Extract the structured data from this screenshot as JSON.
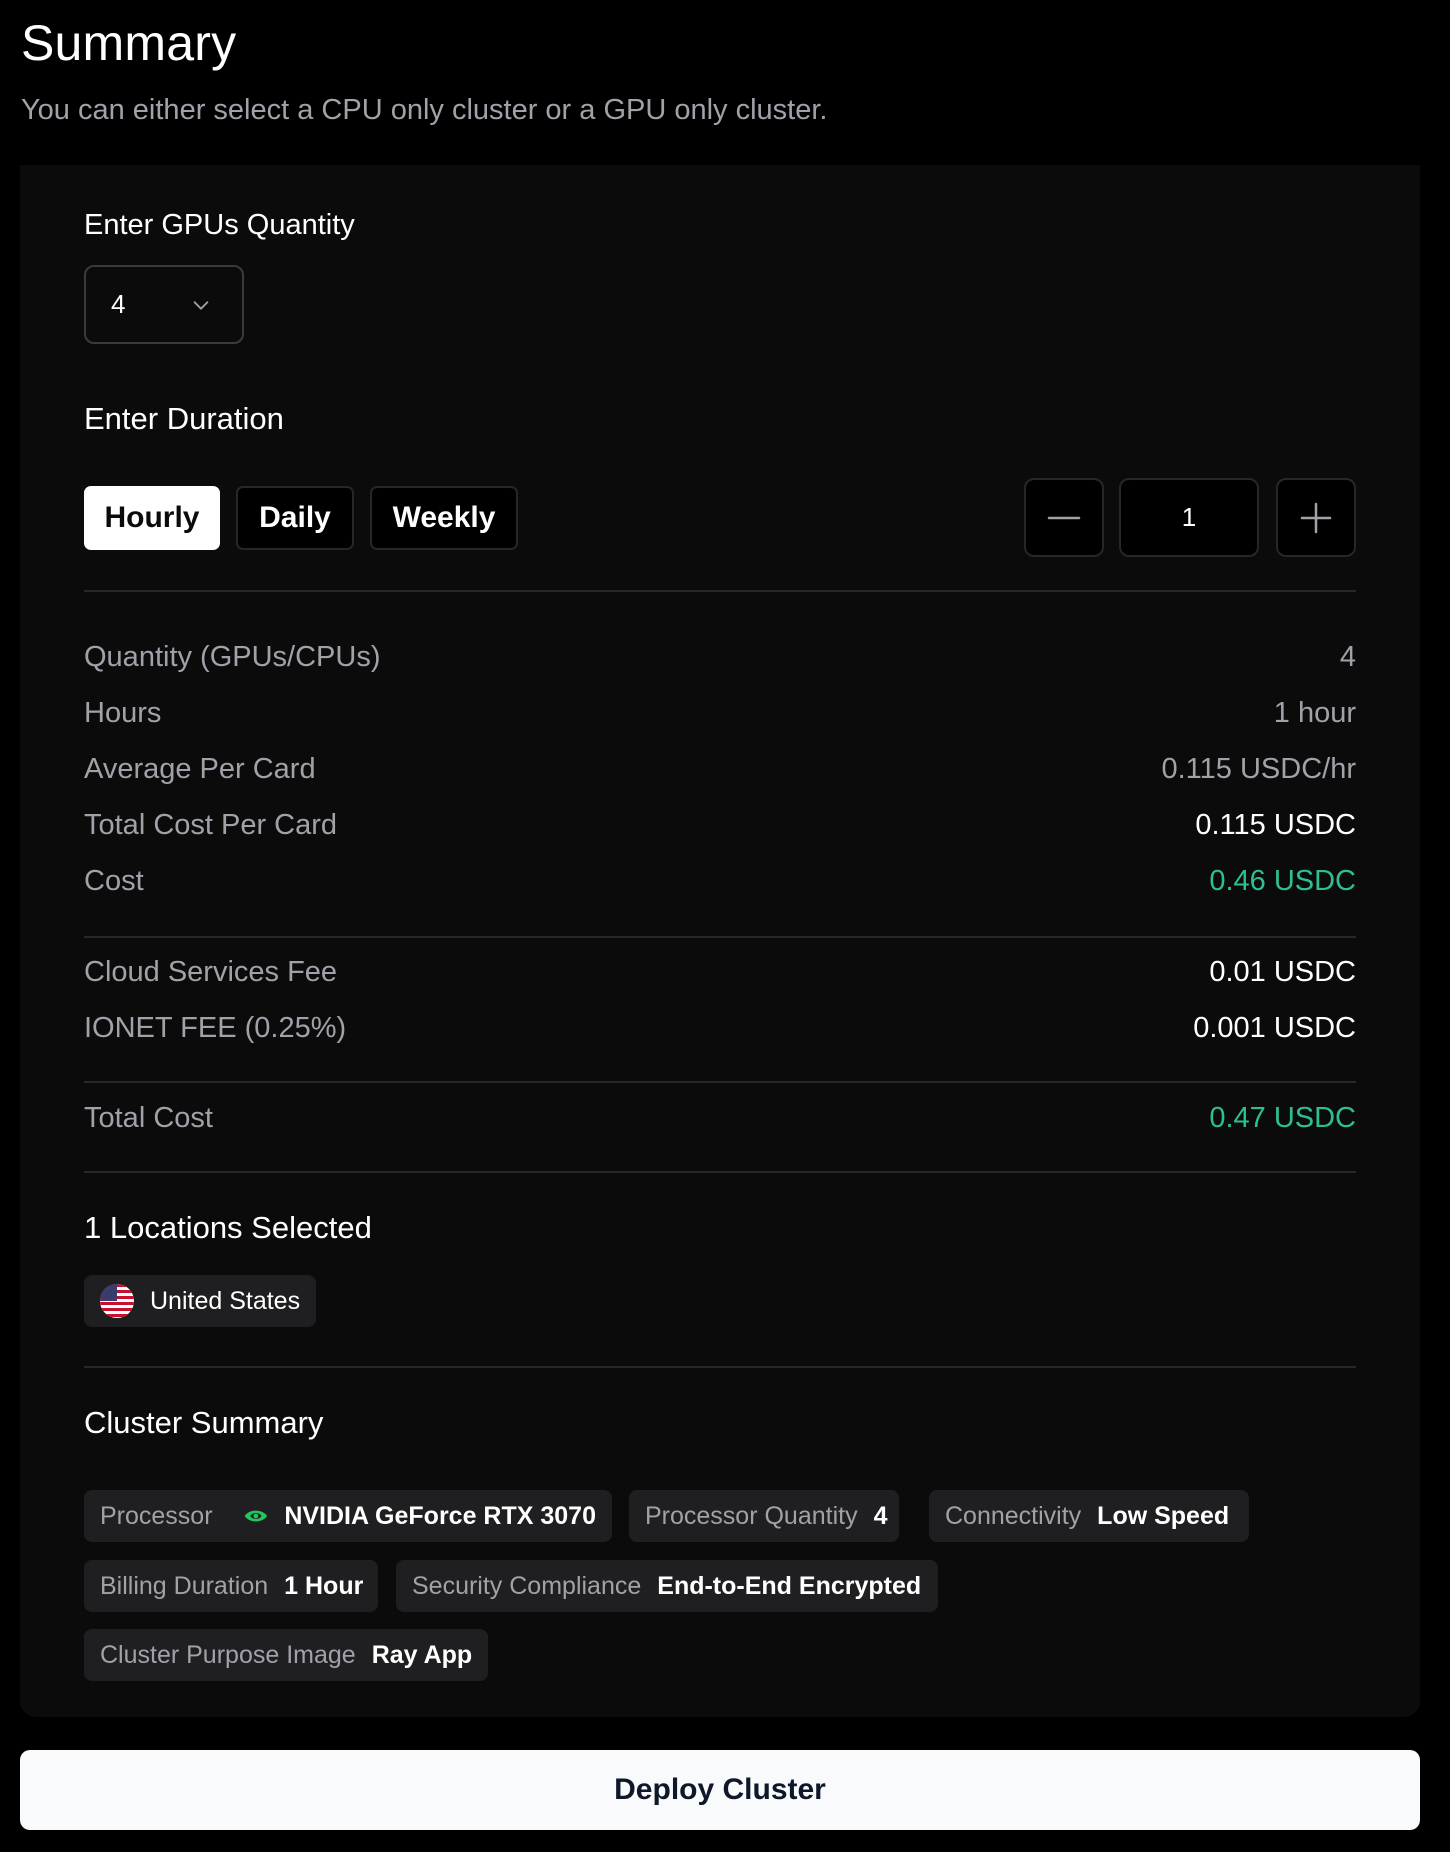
{
  "header": {
    "title": "Summary",
    "subtitle": "You can either select a CPU only cluster or a GPU only cluster."
  },
  "gpu_quantity": {
    "label": "Enter GPUs Quantity",
    "selected": "4"
  },
  "duration": {
    "label": "Enter Duration",
    "tabs": [
      {
        "label": "Hourly",
        "active": true
      },
      {
        "label": "Daily",
        "active": false
      },
      {
        "label": "Weekly",
        "active": false
      }
    ],
    "stepper_value": "1"
  },
  "cost_rows": [
    {
      "label": "Quantity (GPUs/CPUs)",
      "value": "4"
    },
    {
      "label": "Hours",
      "value": "1 hour"
    },
    {
      "label": "Average Per Card",
      "value": "0.115 USDC/hr"
    },
    {
      "label": "Total Cost Per Card",
      "value": "0.115 USDC"
    },
    {
      "label": "Cost",
      "value": "0.46 USDC"
    }
  ],
  "fee_rows": [
    {
      "label": "Cloud Services Fee",
      "value": "0.01 USDC"
    },
    {
      "label": "IONET FEE (0.25%)",
      "value": "0.001 USDC"
    }
  ],
  "total": {
    "label": "Total Cost",
    "value": "0.47 USDC"
  },
  "locations": {
    "title": "1 Locations Selected",
    "items": [
      "United States"
    ]
  },
  "cluster_summary": {
    "title": "Cluster Summary",
    "processor_label": "Processor",
    "processor_value": "NVIDIA GeForce RTX 3070",
    "processor_quantity_label": "Processor Quantity",
    "processor_quantity_value": "4",
    "connectivity_label": "Connectivity",
    "connectivity_value": "Low Speed",
    "billing_label": "Billing Duration",
    "billing_value": "1 Hour",
    "security_label": "Security Compliance",
    "security_value": "End-to-End Encrypted",
    "purpose_label": "Cluster Purpose Image",
    "purpose_value": "Ray App"
  },
  "deploy_button": "Deploy Cluster",
  "colors": {
    "background": "#000000",
    "panel": "#0b0b0b",
    "accent_green": "#2dbf94",
    "chip_bg": "#1f1f22",
    "muted_text": "#a1a1aa"
  },
  "icons": [
    "chevron-down-icon",
    "minus-icon",
    "plus-icon",
    "us-flag-icon",
    "nvidia-logo-icon"
  ]
}
